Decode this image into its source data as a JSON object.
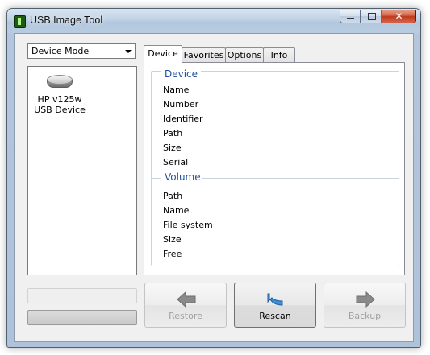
{
  "window": {
    "title": "USB Image Tool"
  },
  "mode_select": {
    "value": "Device Mode"
  },
  "device_list": [
    {
      "name_line1": "HP v125w",
      "name_line2": "USB Device"
    }
  ],
  "tabs": [
    {
      "label": "Device",
      "active": true
    },
    {
      "label": "Favorites",
      "active": false
    },
    {
      "label": "Options",
      "active": false
    },
    {
      "label": "Info",
      "active": false
    }
  ],
  "device_group": {
    "title": "Device",
    "fields": [
      "Name",
      "Number",
      "Identifier",
      "Path",
      "Size",
      "Serial"
    ]
  },
  "volume_group": {
    "title": "Volume",
    "fields": [
      "Path",
      "Name",
      "File system",
      "Size",
      "Free"
    ]
  },
  "buttons": {
    "restore": {
      "label": "Restore",
      "enabled": false
    },
    "rescan": {
      "label": "Rescan",
      "enabled": true
    },
    "backup": {
      "label": "Backup",
      "enabled": false
    }
  },
  "colors": {
    "group_title": "#1f4e9e",
    "disabled_icon": "#8a8a8a",
    "rescan_icon": "#3c8fd6"
  }
}
